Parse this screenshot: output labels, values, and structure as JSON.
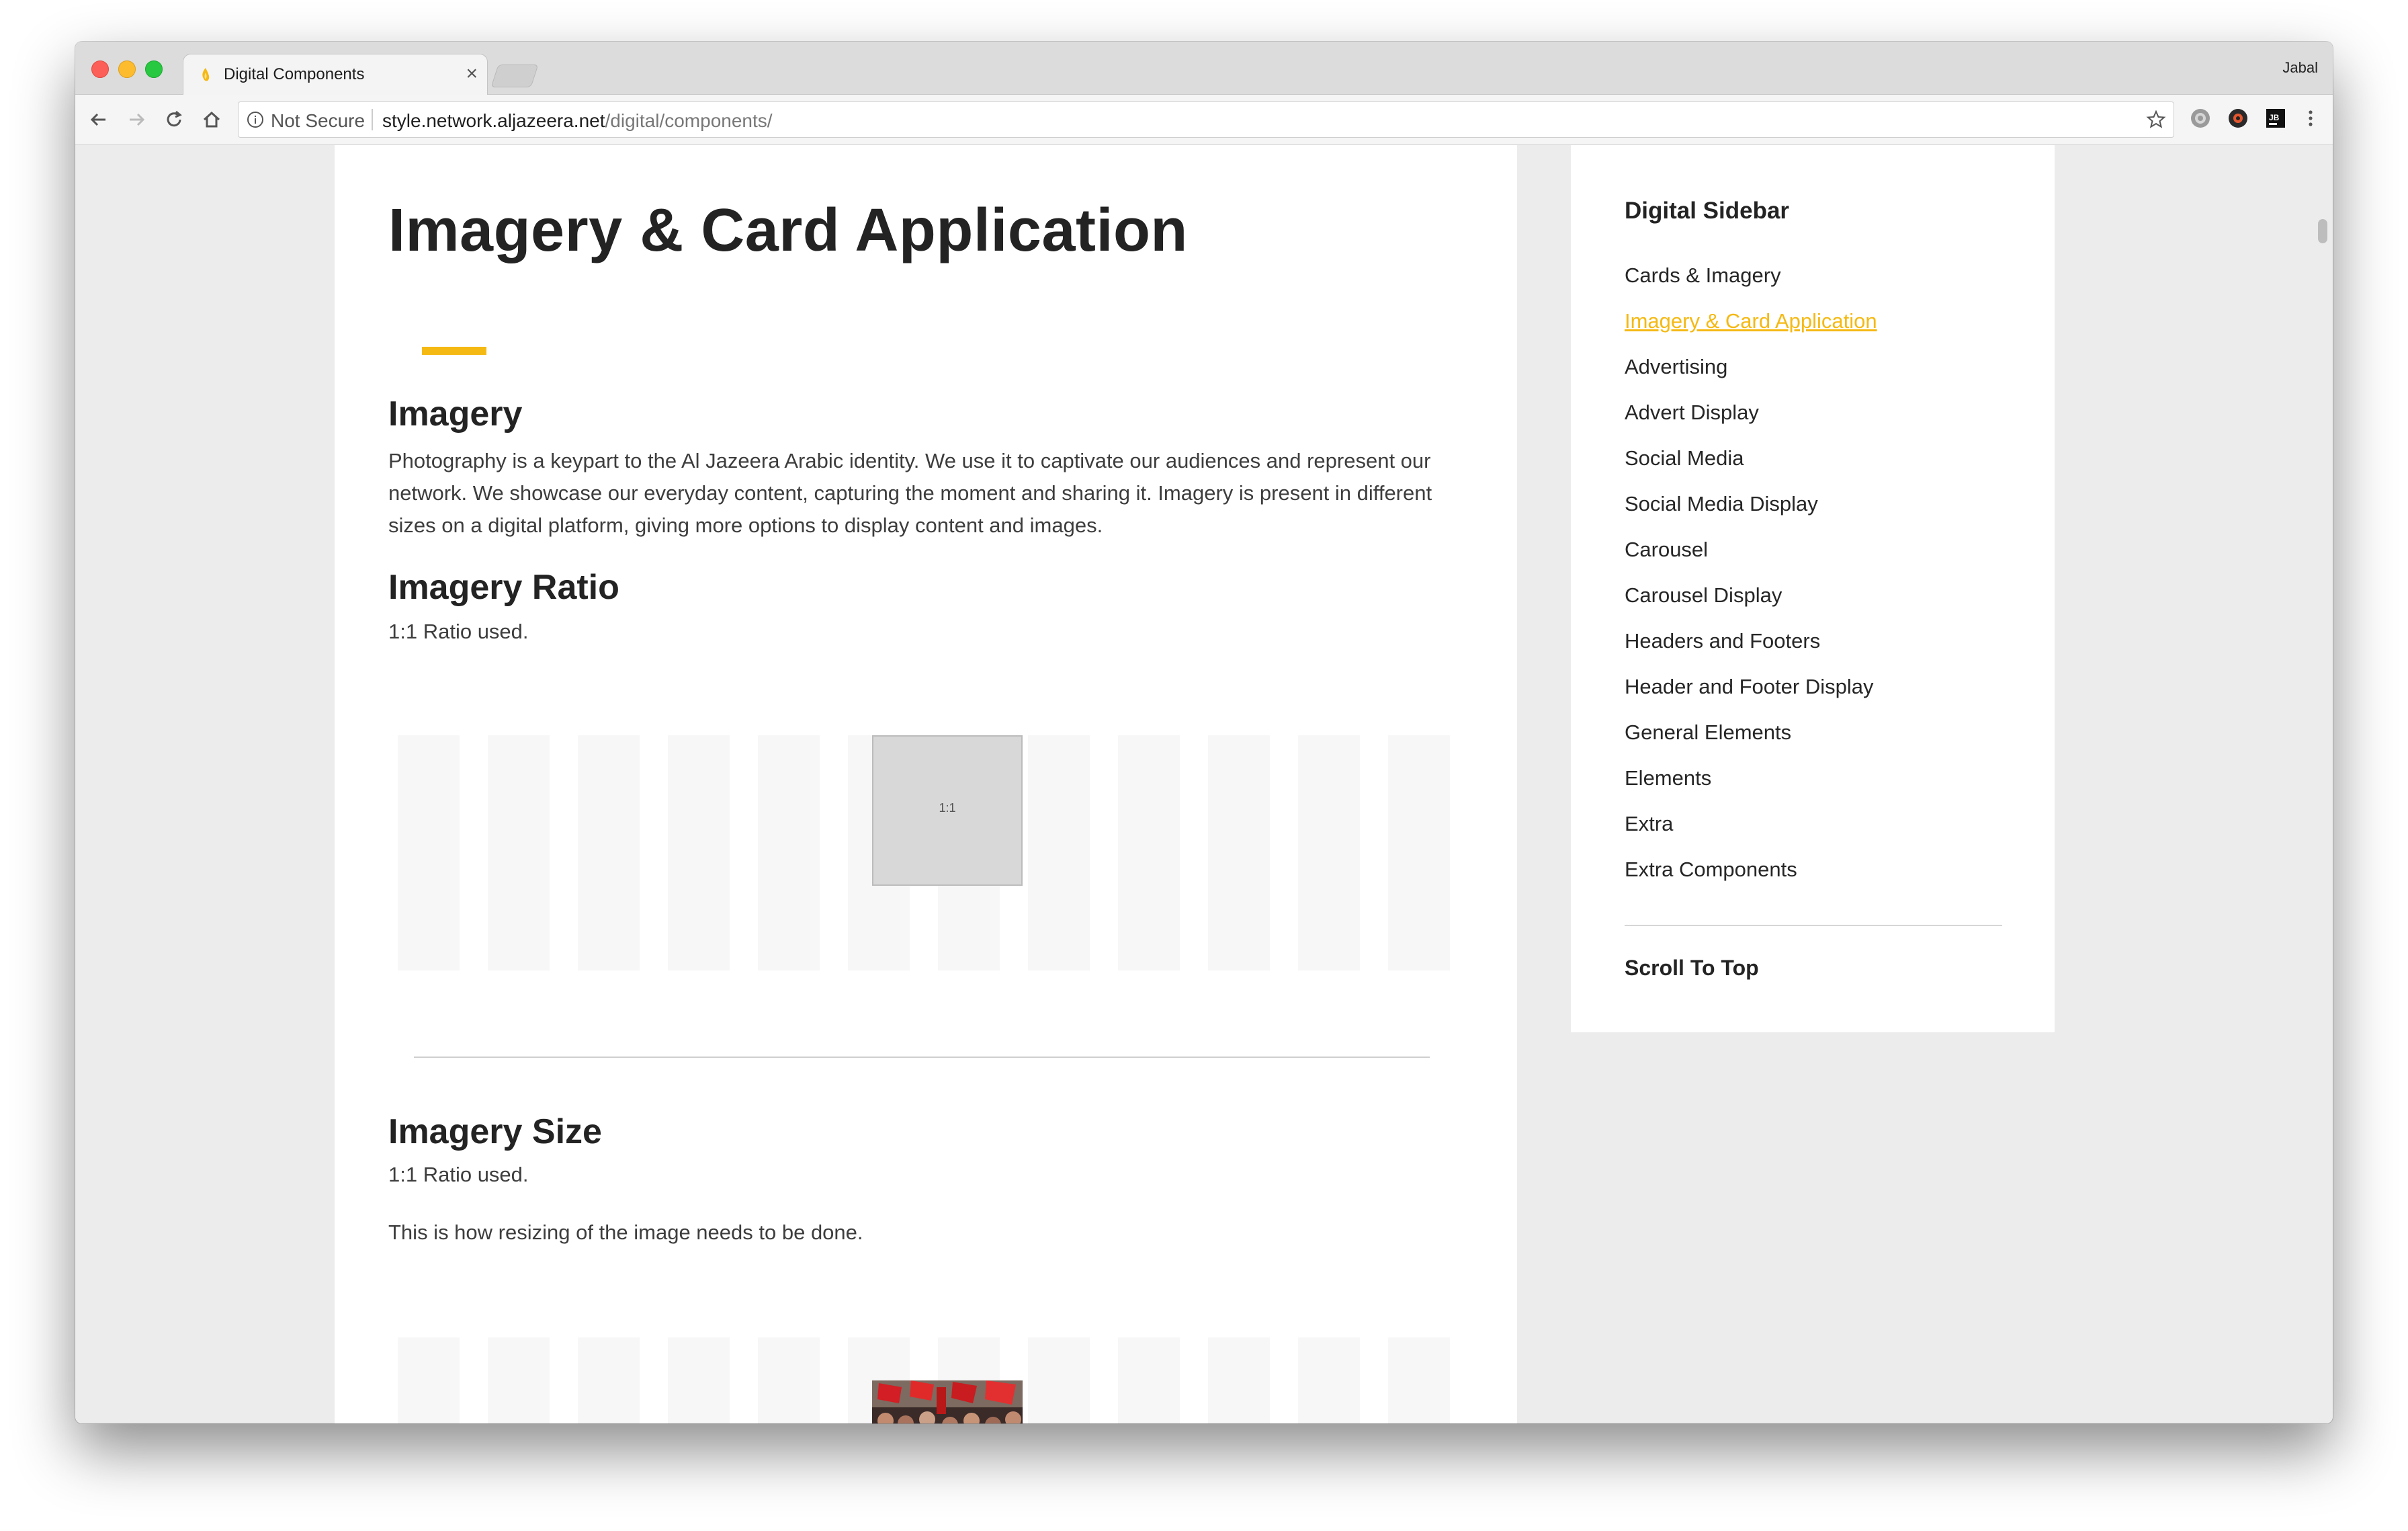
{
  "browser": {
    "tab_title": "Digital Components",
    "tab_close": "×",
    "profile_name": "Jabal",
    "security_label": "Not Secure",
    "url_host": "style.network.aljazeera.net",
    "url_path": "/digital/components/",
    "accent_color": "#f5b913"
  },
  "main": {
    "title": "Imagery & Card Application",
    "imagery_heading": "Imagery",
    "imagery_text": "Photography is a keypart to the Al Jazeera Arabic identity. We use it to captivate our audiences and represent our network. We showcase our everyday content, capturing the moment and sharing it. Imagery is present in different sizes on a digital platform, giving more options to display content and images.",
    "ratio_heading": "Imagery Ratio",
    "ratio_text": "1:1 Ratio used.",
    "ratio_box_label": "1:1",
    "size_heading": "Imagery Size",
    "size_text": "1:1 Ratio used.",
    "size_note": "This is how resizing of the image needs to be done."
  },
  "sidebar": {
    "title": "Digital Sidebar",
    "items": [
      {
        "label": "Cards & Imagery",
        "active": false
      },
      {
        "label": "Imagery & Card Application",
        "active": true
      },
      {
        "label": "Advertising",
        "active": false
      },
      {
        "label": "Advert Display",
        "active": false
      },
      {
        "label": "Social Media",
        "active": false
      },
      {
        "label": "Social Media Display",
        "active": false
      },
      {
        "label": "Carousel",
        "active": false
      },
      {
        "label": "Carousel Display",
        "active": false
      },
      {
        "label": "Headers and Footers",
        "active": false
      },
      {
        "label": "Header and Footer Display",
        "active": false
      },
      {
        "label": "General Elements",
        "active": false
      },
      {
        "label": "Elements",
        "active": false
      },
      {
        "label": "Extra",
        "active": false
      },
      {
        "label": "Extra Components",
        "active": false
      }
    ],
    "scroll_to_top": "Scroll To Top"
  }
}
